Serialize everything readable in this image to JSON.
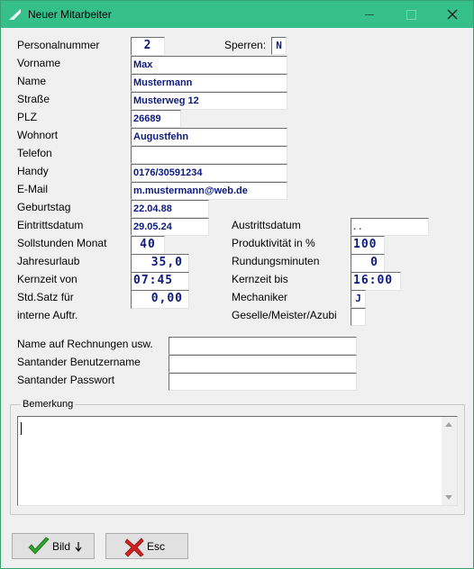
{
  "window": {
    "title": "Neuer Mitarbeiter",
    "accent": "#35c08a"
  },
  "labels": {
    "personalnummer": "Personalnummer",
    "sperren": "Sperren:",
    "vorname": "Vorname",
    "name": "Name",
    "strasse": "Straße",
    "plz": "PLZ",
    "wohnort": "Wohnort",
    "telefon": "Telefon",
    "handy": "Handy",
    "email": "E-Mail",
    "geburtstag": "Geburtstag",
    "eintrittsdatum": "Eintrittsdatum",
    "austrittsdatum": "Austrittsdatum",
    "sollstunden": "Sollstunden Monat",
    "produktivitaet": "Produktivität in %",
    "jahresurlaub": "Jahresurlaub",
    "rundungsminuten": "Rundungsminuten",
    "kernzeit_von": "Kernzeit von",
    "kernzeit_bis": "Kernzeit bis",
    "std_satz_1": "Std.Satz für",
    "std_satz_2": "interne Auftr.",
    "mechaniker": "Mechaniker",
    "geselle": "Geselle/Meister/Azubi",
    "name_rechnungen": "Name auf Rechnungen usw.",
    "santander_user": "Santander Benutzername",
    "santander_pw": "Santander Passwort",
    "bemerkung": "Bemerkung"
  },
  "values": {
    "personalnummer": "2",
    "sperren": "N",
    "vorname": "Max",
    "name": "Mustermann",
    "strasse": "Musterweg 12",
    "plz": "26689",
    "wohnort": "Augustfehn",
    "telefon": "",
    "handy": "0176/30591234",
    "email": "m.mustermann@web.de",
    "geburtstag": "22.04.88",
    "eintrittsdatum": "29.05.24",
    "austrittsdatum": " . .",
    "sollstunden": "40",
    "produktivitaet": "100",
    "jahresurlaub": "35,0",
    "rundungsminuten": "0",
    "kernzeit_von": "07:45",
    "kernzeit_bis": "16:00",
    "std_satz": "0,00",
    "mechaniker": "J",
    "geselle": "",
    "name_rechnungen": "",
    "santander_user": "",
    "santander_pw": "",
    "bemerkung": ""
  },
  "buttons": {
    "bild": "Bild",
    "esc": "Esc"
  },
  "icons": {
    "bild": "checkmark-icon",
    "esc": "red-x-icon",
    "bild_arrow": "arrow-down-icon"
  }
}
